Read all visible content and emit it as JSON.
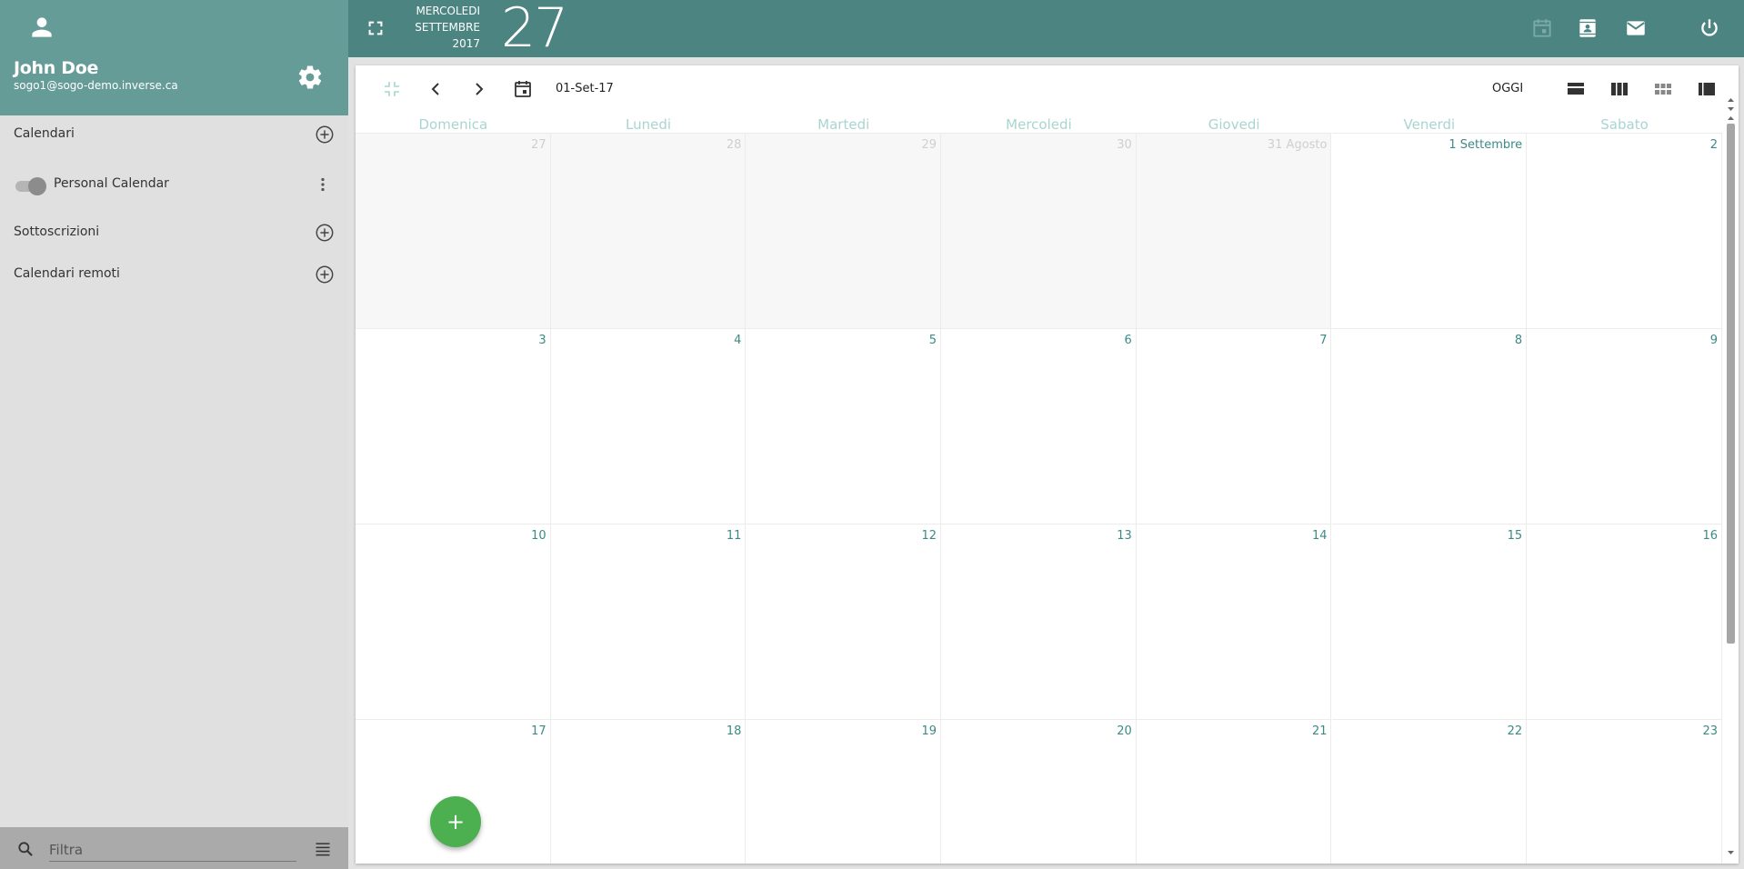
{
  "user": {
    "name": "John Doe",
    "email": "sogo1@sogo-demo.inverse.ca"
  },
  "sidebar": {
    "calendars_label": "Calendari",
    "personal_calendar": "Personal Calendar",
    "subscriptions_label": "Sottoscrizioni",
    "remote_label": "Calendari remoti",
    "filter_placeholder": "Filtra"
  },
  "header": {
    "weekday": "MERCOLEDI",
    "month": "SETTEMBRE",
    "year": "2017",
    "day": "27"
  },
  "toolbar": {
    "current_date": "01-Set-17",
    "today_label": "OGGI"
  },
  "weekdays": [
    "Domenica",
    "Lunedi",
    "Martedi",
    "Mercoledi",
    "Giovedi",
    "Venerdi",
    "Sabato"
  ],
  "weeks": [
    [
      "27",
      "28",
      "29",
      "30",
      "31 Agosto",
      "1 Settembre",
      "2"
    ],
    [
      "3",
      "4",
      "5",
      "6",
      "7",
      "8",
      "9"
    ],
    [
      "10",
      "11",
      "12",
      "13",
      "14",
      "15",
      "16"
    ],
    [
      "17",
      "18",
      "19",
      "20",
      "21",
      "22",
      "23"
    ]
  ],
  "colors": {
    "header_bg": "#4b8481",
    "user_panel_bg": "#669c98",
    "sidebar_bg": "#e0e0e0",
    "accent_text": "#3c8a85",
    "fab": "#4caf50"
  },
  "icons": {
    "avatar": "person-icon",
    "settings": "gear-icon",
    "add": "add-circle-icon",
    "more": "more-vert-icon",
    "search": "search-icon",
    "filter_menu": "list-icon",
    "fullscreen": "fullscreen-icon",
    "calendar_app": "event-icon",
    "contacts": "contacts-icon",
    "mail": "mail-icon",
    "power": "power-icon",
    "collapse": "fullscreen-exit-icon",
    "prev": "chevron-left-icon",
    "next": "chevron-right-icon",
    "date_picker": "calendar-icon",
    "view_day": "view-day-icon",
    "view_week": "view-week-icon",
    "view_month": "view-module-icon",
    "view_list": "view-list-icon",
    "fab": "add-icon"
  }
}
